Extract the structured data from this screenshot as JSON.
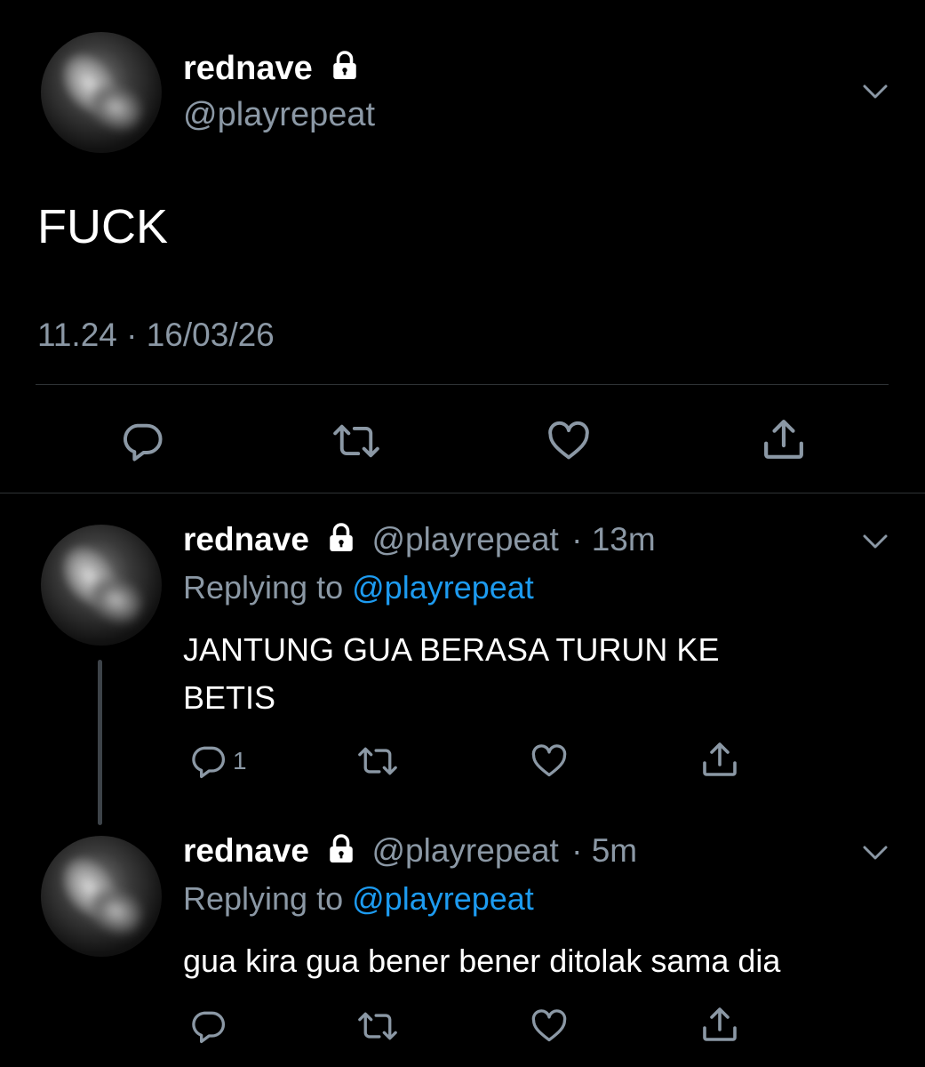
{
  "main_tweet": {
    "display_name": "rednave",
    "handle": "@playrepeat",
    "text": "FUCK",
    "timestamp": "11.24 · 16/03/26",
    "icons": [
      "lock-icon",
      "chevron-down-icon",
      "reply-icon",
      "retweet-icon",
      "like-icon",
      "share-icon"
    ]
  },
  "replies": [
    {
      "display_name": "rednave",
      "handle": "@playrepeat",
      "time": "· 13m",
      "replying_prefix": "Replying to",
      "replying_to": "@playrepeat",
      "text": "JANTUNG GUA BERASA TURUN KE BETIS",
      "reply_count": "1"
    },
    {
      "display_name": "rednave",
      "handle": "@playrepeat",
      "time": "· 5m",
      "replying_prefix": "Replying to",
      "replying_to": "@playrepeat",
      "text": "gua kira gua bener bener ditolak sama dia",
      "reply_count": ""
    }
  ],
  "colors": {
    "background": "#000000",
    "text": "#ffffff",
    "secondary": "#8b98a5",
    "accent": "#1d9bf0",
    "divider": "#2f3336"
  }
}
